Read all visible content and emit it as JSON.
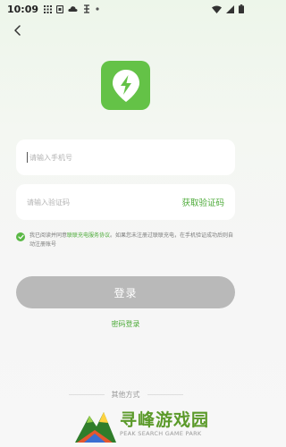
{
  "status_bar": {
    "time": "10:09"
  },
  "form": {
    "phone_placeholder": "请输入手机号",
    "code_placeholder": "请输入验证码",
    "get_code_label": "获取验证码"
  },
  "agreement": {
    "prefix": "我已阅读并同意",
    "link": "联联充电服务协议",
    "suffix": "。如果您未注册过联联充电，在手机验证成功后则自动注册账号"
  },
  "actions": {
    "login_label": "登录",
    "password_login_label": "密码登录"
  },
  "other_ways": {
    "label": "其他方式"
  },
  "watermark": {
    "title": "寻峰游戏园",
    "subtitle": "PEAK SEARCH GAME PARK"
  },
  "colors": {
    "brand_green": "#64c247",
    "link_green": "#4caa38",
    "disabled_button": "#b9b9b9",
    "watermark_green": "#5b9a2a"
  },
  "icons": {
    "back": "back-arrow-icon",
    "app_logo": "charging-bolt-icon",
    "checkbox": "checked-circle-icon"
  }
}
